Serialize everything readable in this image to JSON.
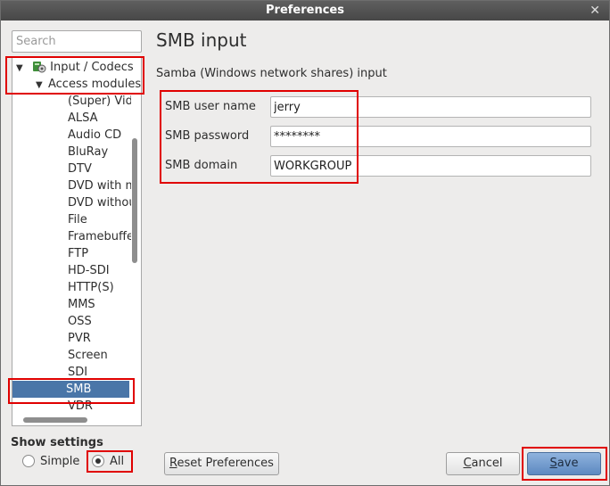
{
  "window": {
    "title": "Preferences"
  },
  "search": {
    "placeholder": "Search"
  },
  "tree": {
    "root_label": "Input / Codecs",
    "child_label": "Access modules",
    "items": [
      "(Super) Video CD",
      "ALSA",
      "Audio CD",
      "BluRay",
      "DTV",
      "DVD with menus",
      "DVD without menus",
      "File",
      "Framebuffer",
      "FTP",
      "HD-SDI",
      "HTTP(S)",
      "MMS",
      "OSS",
      "PVR",
      "Screen",
      "SDI",
      "SMB",
      "VDR"
    ],
    "selected": "SMB"
  },
  "show_settings": {
    "label": "Show settings",
    "simple": "Simple",
    "all": "All",
    "selected": "All"
  },
  "panel": {
    "title": "SMB input",
    "subtitle": "Samba (Windows network shares) input",
    "fields": [
      {
        "label": "SMB user name",
        "value": "jerry"
      },
      {
        "label": "SMB password",
        "value": "********"
      },
      {
        "label": "SMB domain",
        "value": "WORKGROUP"
      }
    ]
  },
  "buttons": {
    "reset_prefix": "R",
    "reset_rest": "eset Preferences",
    "cancel_prefix": "C",
    "cancel_rest": "ancel",
    "save_prefix": "S",
    "save_rest": "ave"
  },
  "colors": {
    "highlight": "#e00000",
    "selection": "#4a76a8",
    "titlebar": "#4f4f4f"
  }
}
